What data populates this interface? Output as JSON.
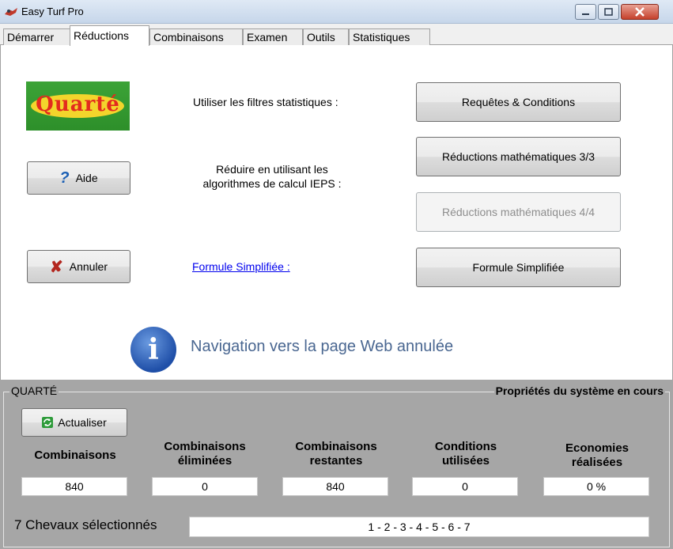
{
  "window": {
    "title": "Easy Turf Pro"
  },
  "tabs": [
    {
      "label": "Démarrer"
    },
    {
      "label": "Réductions",
      "active": true
    },
    {
      "label": "Combinaisons"
    },
    {
      "label": "Examen"
    },
    {
      "label": "Outils"
    },
    {
      "label": "Statistiques"
    }
  ],
  "main": {
    "logo_text": "Quarté",
    "filters_label": "Utiliser les filtres statistiques :",
    "requetes_button": "Requêtes & Conditions",
    "aide_button": "Aide",
    "reduire_label_1": "Réduire en utilisant les",
    "reduire_label_2": "algorithmes de calcul IEPS :",
    "reductions_33_button": "Réductions mathématiques 3/3",
    "reductions_44_button": "Réductions mathématiques 4/4",
    "annuler_button": "Annuler",
    "formule_link": "Formule Simplifiée :",
    "formule_button": "Formule Simplifiée",
    "navigation_message": "Navigation vers la page Web annulée"
  },
  "system": {
    "group_title": "QUARTÉ",
    "group_right_title": "Propriétés du système en cours",
    "actualiser_button": "Actualiser",
    "stats": [
      {
        "header_1": "Combinaisons",
        "header_2": "",
        "value": "840"
      },
      {
        "header_1": "Combinaisons",
        "header_2": "éliminées",
        "value": "0"
      },
      {
        "header_1": "Combinaisons",
        "header_2": "restantes",
        "value": "840"
      },
      {
        "header_1": "Conditions",
        "header_2": "utilisées",
        "value": "0"
      },
      {
        "header_1": "Economies",
        "header_2": "réalisées",
        "value": "0 %"
      }
    ],
    "horses_label": "7 Chevaux sélectionnés",
    "horses_value": "1 - 2 - 3 - 4 - 5 - 6 - 7"
  },
  "colors": {
    "link": "#0000ee",
    "nav_message": "#4a6791",
    "panel_bg": "#a6a6a6"
  }
}
